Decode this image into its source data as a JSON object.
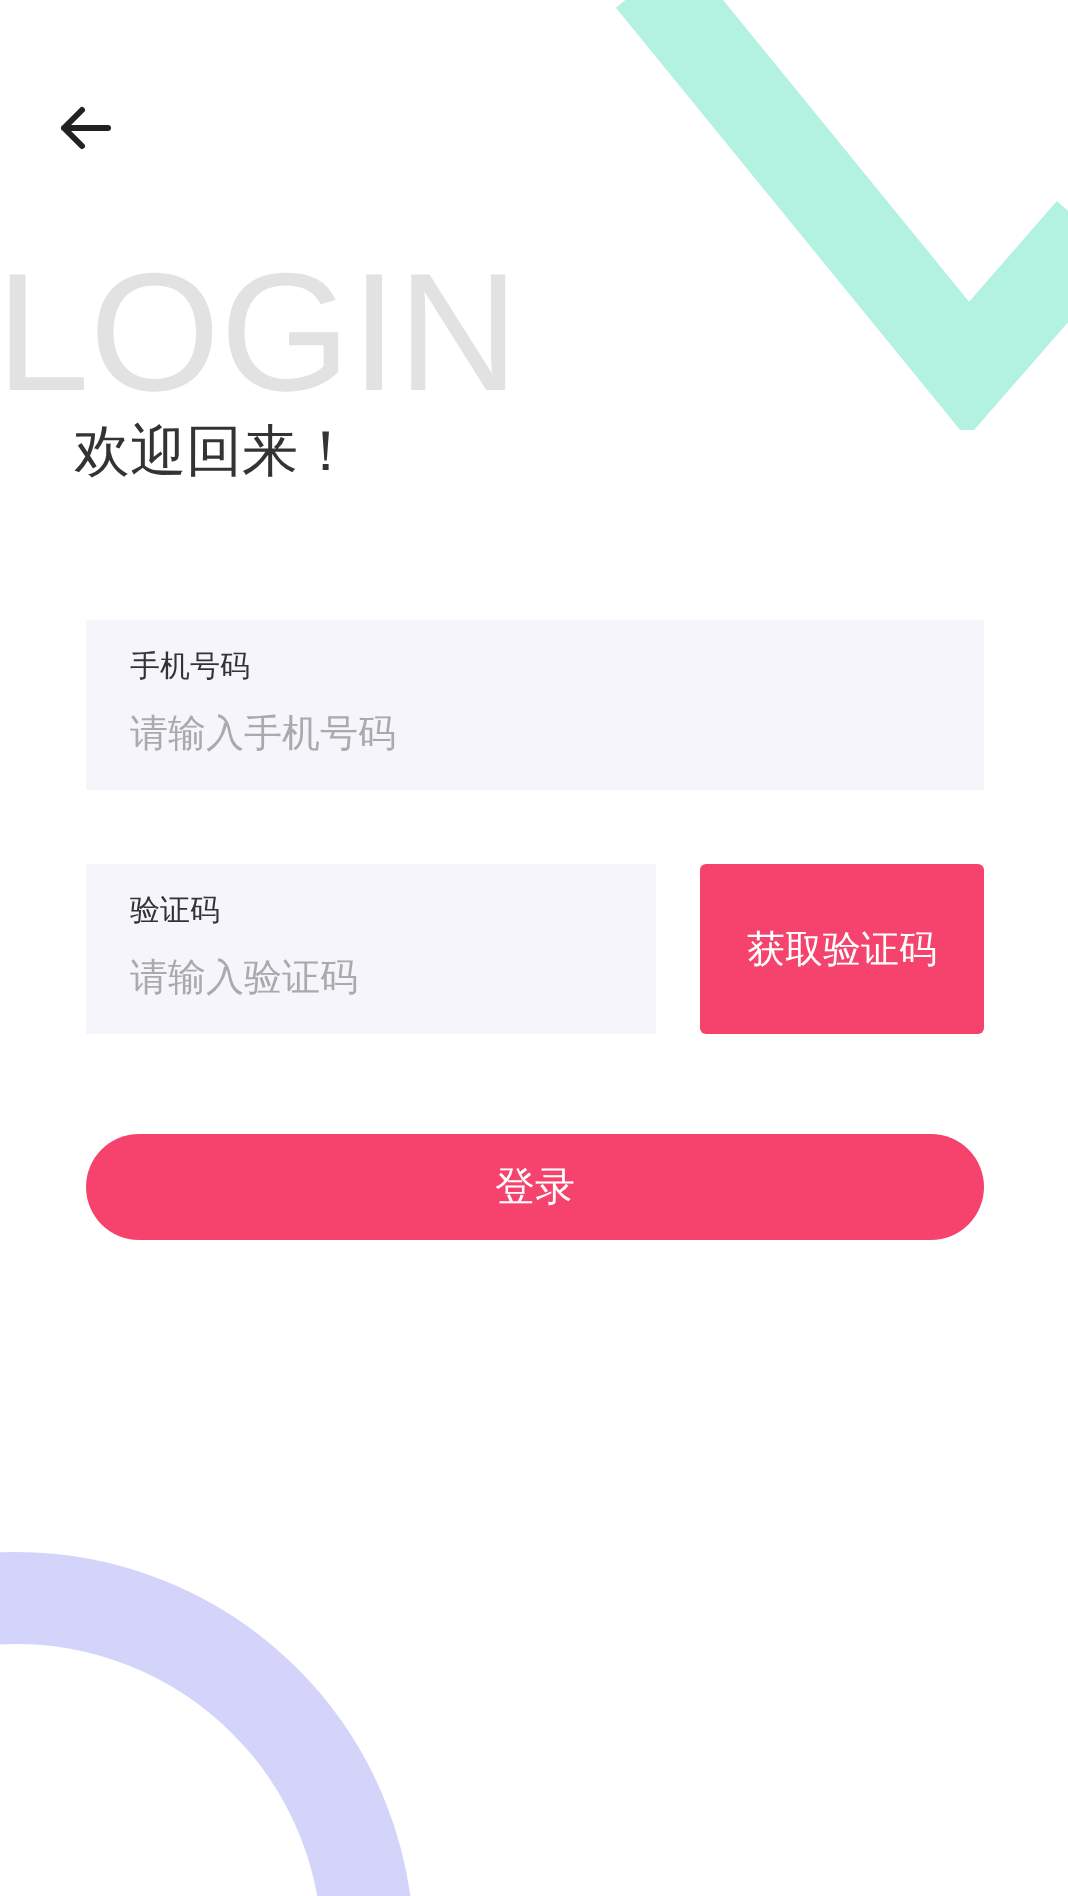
{
  "background_word": "LOGIN",
  "heading": "欢迎回来！",
  "phone_field": {
    "label": "手机号码",
    "placeholder": "请输入手机号码"
  },
  "code_field": {
    "label": "验证码",
    "placeholder": "请输入验证码"
  },
  "get_code_button": "获取验证码",
  "login_button": "登录"
}
